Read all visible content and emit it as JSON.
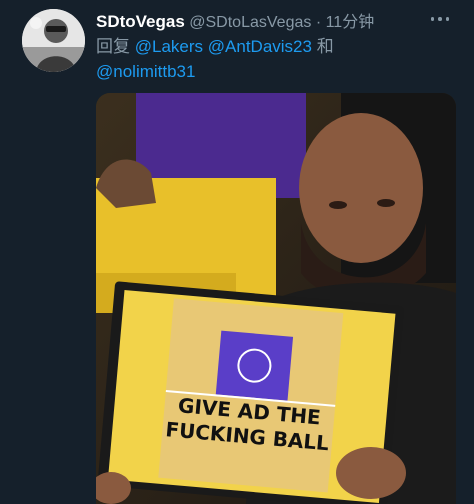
{
  "tweet": {
    "display_name": "SDtoVegas",
    "handle": "@SDtoLasVegas",
    "separator": "·",
    "time": "11分钟",
    "reply_prefix": "回复",
    "mentions": [
      "@Lakers",
      "@AntDavis23"
    ],
    "conjunction": "和",
    "mention_last": "@nolimittb31"
  },
  "media": {
    "board_text_line1": "GIVE AD THE",
    "board_text_line2": "FUCKING BALL"
  },
  "colors": {
    "background": "#15202b",
    "accent": "#1d9bf0",
    "muted": "#8899a6"
  }
}
